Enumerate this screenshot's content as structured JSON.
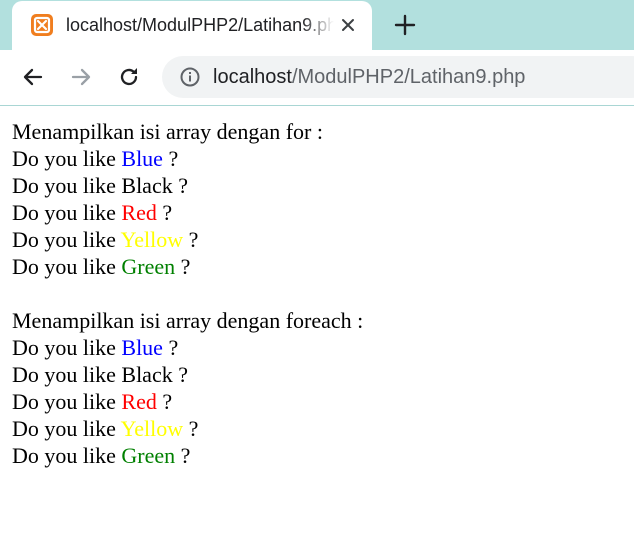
{
  "browser": {
    "tab_title": "localhost/ModulPHP2/Latihan9.php",
    "url_host": "localhost",
    "url_path": "/ModulPHP2/Latihan9.php",
    "favicon": "xampp-icon",
    "theme_color": "#b2e0de"
  },
  "page": {
    "sections": [
      {
        "heading": "Menampilkan isi array dengan for :",
        "lines": [
          {
            "prefix": "Do you like ",
            "color_name": "Blue",
            "color": "#0000ff",
            "suffix": " ?"
          },
          {
            "prefix": "Do you like ",
            "color_name": "Black",
            "color": "#000000",
            "suffix": " ?"
          },
          {
            "prefix": "Do you like ",
            "color_name": "Red",
            "color": "#ff0000",
            "suffix": " ?"
          },
          {
            "prefix": "Do you like ",
            "color_name": "Yellow",
            "color": "#ffff00",
            "suffix": " ?"
          },
          {
            "prefix": "Do you like ",
            "color_name": "Green",
            "color": "#008000",
            "suffix": " ?"
          }
        ]
      },
      {
        "heading": "Menampilkan isi array dengan foreach :",
        "lines": [
          {
            "prefix": "Do you like ",
            "color_name": "Blue",
            "color": "#0000ff",
            "suffix": " ?"
          },
          {
            "prefix": "Do you like ",
            "color_name": "Black",
            "color": "#000000",
            "suffix": " ?"
          },
          {
            "prefix": "Do you like ",
            "color_name": "Red",
            "color": "#ff0000",
            "suffix": " ?"
          },
          {
            "prefix": "Do you like ",
            "color_name": "Yellow",
            "color": "#ffff00",
            "suffix": " ?"
          },
          {
            "prefix": "Do you like ",
            "color_name": "Green",
            "color": "#008000",
            "suffix": " ?"
          }
        ]
      }
    ]
  }
}
